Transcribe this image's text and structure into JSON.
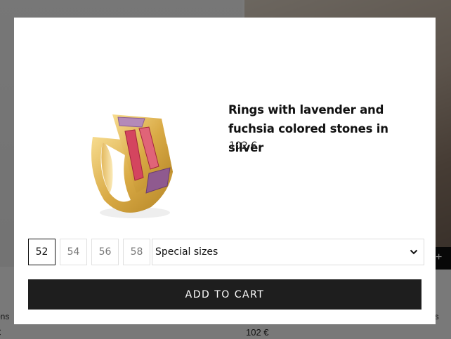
{
  "background": {
    "price_left": "€",
    "price_right": "102 €",
    "caption_left": "ons",
    "caption_right": "es",
    "cta_icon": "+"
  },
  "modal": {
    "title_line1": "Rings with lavender and",
    "title_line2": "fuchsia colored stones in silver",
    "price": "102 €",
    "image_icon": "ring-image",
    "sizes": [
      "52",
      "54",
      "56",
      "58"
    ],
    "selected_size": "52",
    "special_sizes_label": "Special sizes",
    "add_to_cart_label": "ADD TO CART"
  }
}
